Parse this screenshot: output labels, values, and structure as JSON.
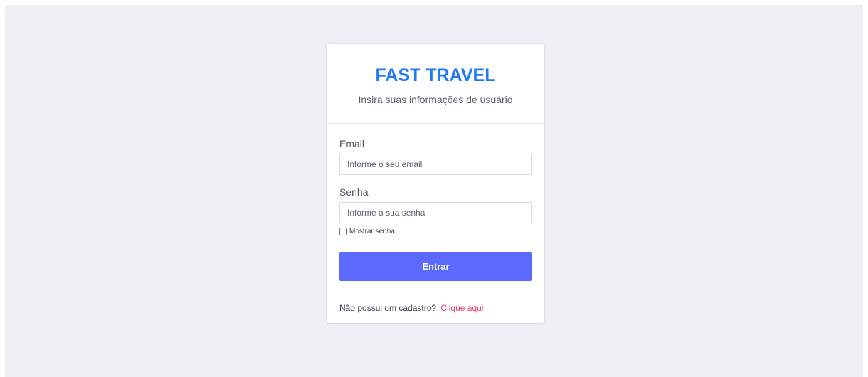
{
  "colors": {
    "background": "#eeeff4",
    "brand": "#1f7af5",
    "primary_button": "#5b69ff",
    "link": "#f23b6b"
  },
  "header": {
    "brand": "FAST TRAVEL",
    "subtitle": "Insira suas informações de usuário"
  },
  "form": {
    "email_label": "Email",
    "email_value": "",
    "email_placeholder": "Informe o seu email",
    "password_label": "Senha",
    "password_value": "",
    "password_placeholder": "Informe a sua senha",
    "show_password_label": "Mostrar senha",
    "show_password_checked": false,
    "submit_label": "Entrar"
  },
  "footer": {
    "prompt": "Não possui um cadastro?",
    "link_text": "Clique aqui"
  }
}
